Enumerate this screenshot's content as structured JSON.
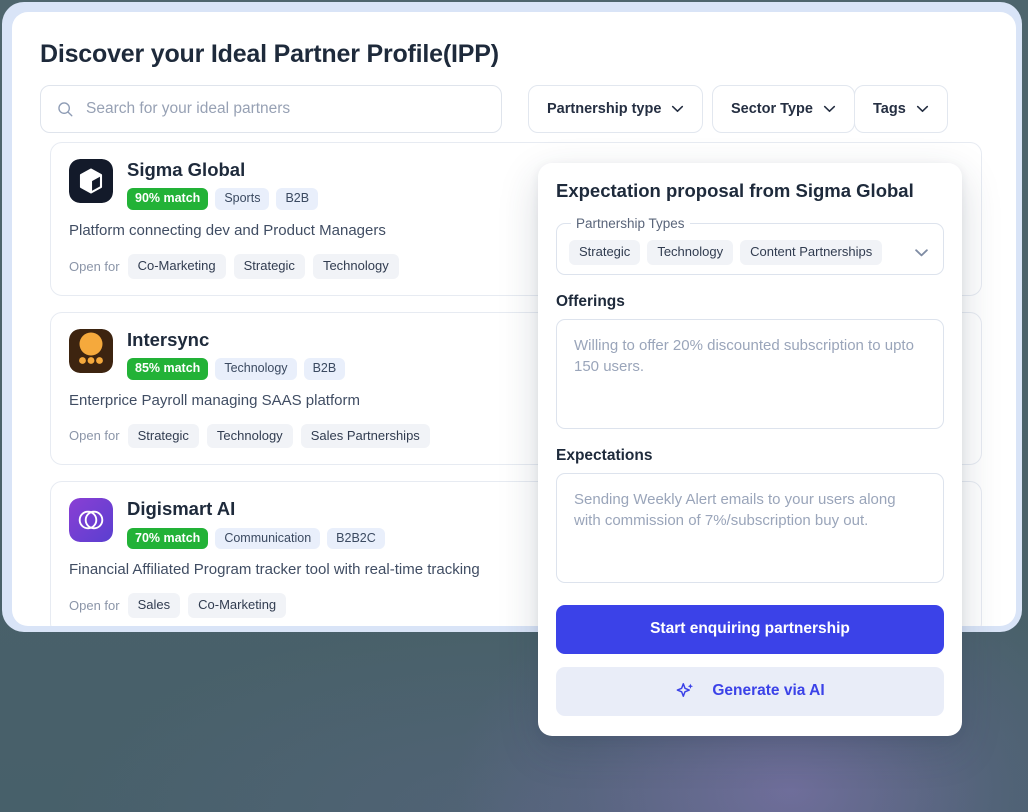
{
  "page": {
    "title": "Discover your Ideal Partner Profile(IPP)"
  },
  "search": {
    "placeholder": "Search for your ideal partners",
    "icon": "search-icon"
  },
  "filters": [
    {
      "label": "Partnership type",
      "icon": "chevron-down-icon"
    },
    {
      "label": "Sector Type",
      "icon": "chevron-down-icon"
    },
    {
      "label": "Tags",
      "icon": "chevron-down-icon"
    }
  ],
  "partners": [
    {
      "name": "Sigma Global",
      "logo_icon": "cube-logo-icon",
      "match": "90% match",
      "tags": [
        "Sports",
        "B2B"
      ],
      "description": "Platform connecting dev and Product Managers",
      "open_for_label": "Open for",
      "open_for": [
        "Co-Marketing",
        "Strategic",
        "Technology"
      ]
    },
    {
      "name": "Intersync",
      "logo_icon": "circle-dots-logo-icon",
      "match": "85% match",
      "tags": [
        "Technology",
        "B2B"
      ],
      "description": "Enterprice Payroll managing SAAS platform",
      "open_for_label": "Open for",
      "open_for": [
        "Strategic",
        "Technology",
        "Sales Partnerships"
      ]
    },
    {
      "name": "Digismart AI",
      "logo_icon": "overlapping-circles-logo-icon",
      "match": "70% match",
      "tags": [
        "Communication",
        "B2B2C"
      ],
      "description": "Financial Affiliated Program tracker tool with real-time tracking",
      "open_for_label": "Open for",
      "open_for": [
        "Sales",
        "Co-Marketing"
      ]
    }
  ],
  "modal": {
    "title": "Expectation proposal from Sigma Global",
    "partnership_types": {
      "legend": "Partnership Types",
      "values": [
        "Strategic",
        "Technology",
        "Content Partnerships"
      ],
      "icon": "chevron-down-icon"
    },
    "offerings": {
      "label": "Offerings",
      "placeholder": "Willing to offer 20% discounted subscription to upto 150 users."
    },
    "expectations": {
      "label": "Expectations",
      "placeholder": "Sending Weekly Alert emails to your users along with commission of 7%/subscription buy out."
    },
    "primary_button": "Start enquiring partnership",
    "secondary_button": "Generate via AI",
    "secondary_icon": "sparkle-icon"
  },
  "colors": {
    "accent": "#3b42e8",
    "match_badge": "#22b237",
    "tag_pill": "#e9effb",
    "background": "#4a6169",
    "frame": "#d9e4f7",
    "title_text": "#1e2a3b"
  }
}
